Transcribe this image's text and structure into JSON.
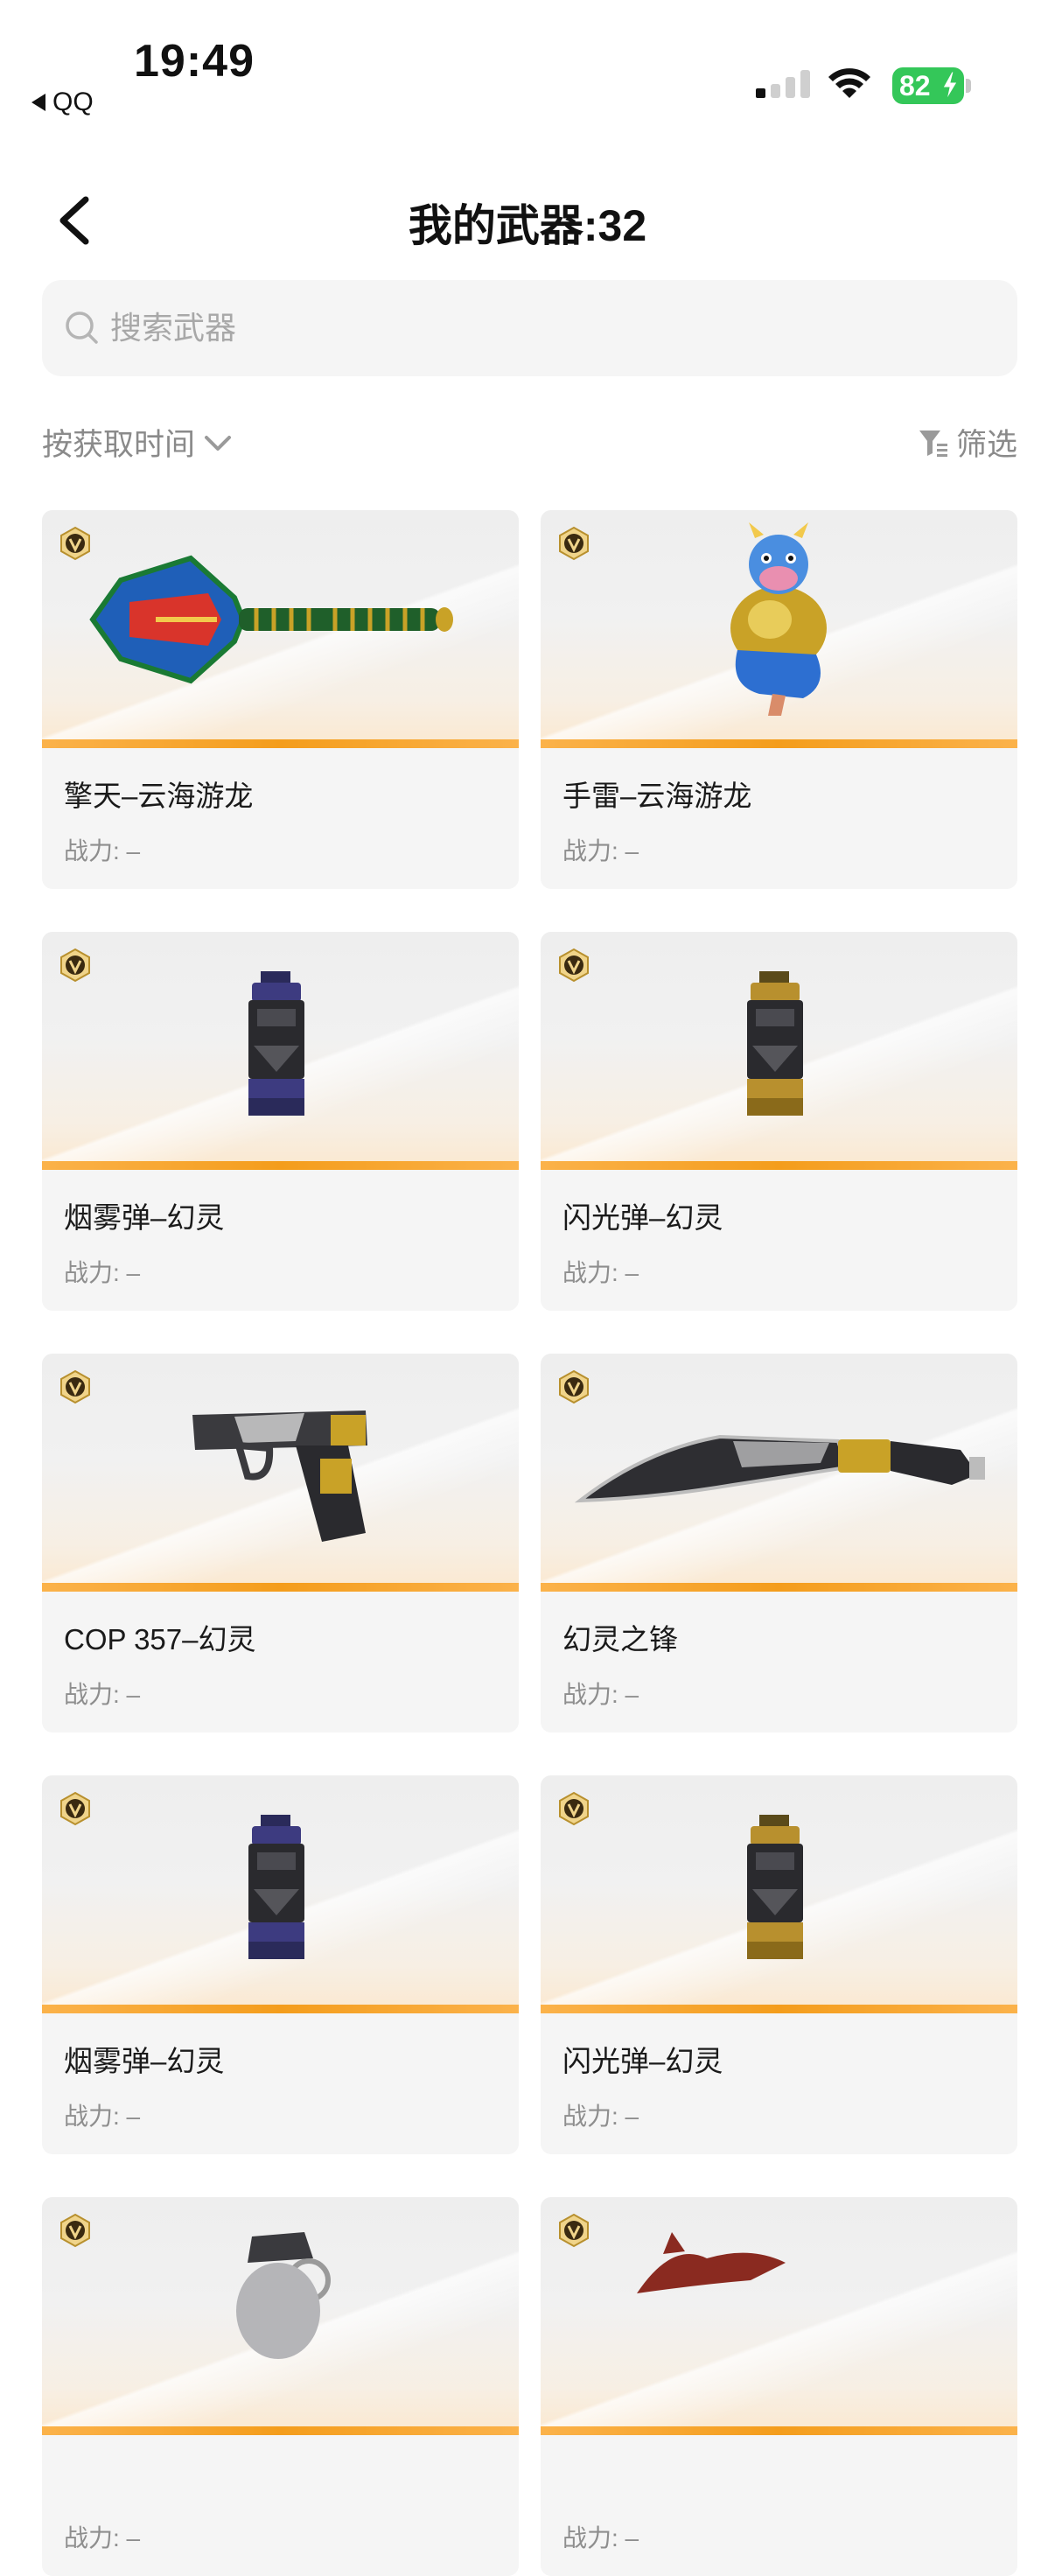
{
  "status_bar": {
    "time": "19:49",
    "back_app": "QQ",
    "battery": "82"
  },
  "header": {
    "title": "我的武器:32"
  },
  "search": {
    "placeholder": "搜索武器"
  },
  "toolbar": {
    "sort_label": "按获取时间",
    "filter_label": "筛选"
  },
  "power_label": "战力: –",
  "items": [
    {
      "name": "擎天–云海游龙",
      "icon": "shovel-weapon"
    },
    {
      "name": "手雷–云海游龙",
      "icon": "dragon-grenade"
    },
    {
      "name": "烟雾弹–幻灵",
      "icon": "smoke-grenade"
    },
    {
      "name": "闪光弹–幻灵",
      "icon": "flash-grenade"
    },
    {
      "name": "COP 357–幻灵",
      "icon": "pistol"
    },
    {
      "name": "幻灵之锋",
      "icon": "machete"
    },
    {
      "name": "烟雾弹–幻灵",
      "icon": "smoke-grenade"
    },
    {
      "name": "闪光弹–幻灵",
      "icon": "flash-grenade"
    },
    {
      "name": "",
      "icon": "grenade"
    },
    {
      "name": "",
      "icon": "beast-weapon"
    }
  ],
  "colors": {
    "accent": "#f49d1c",
    "battery": "#34c759",
    "card_bg": "#f5f5f5"
  }
}
